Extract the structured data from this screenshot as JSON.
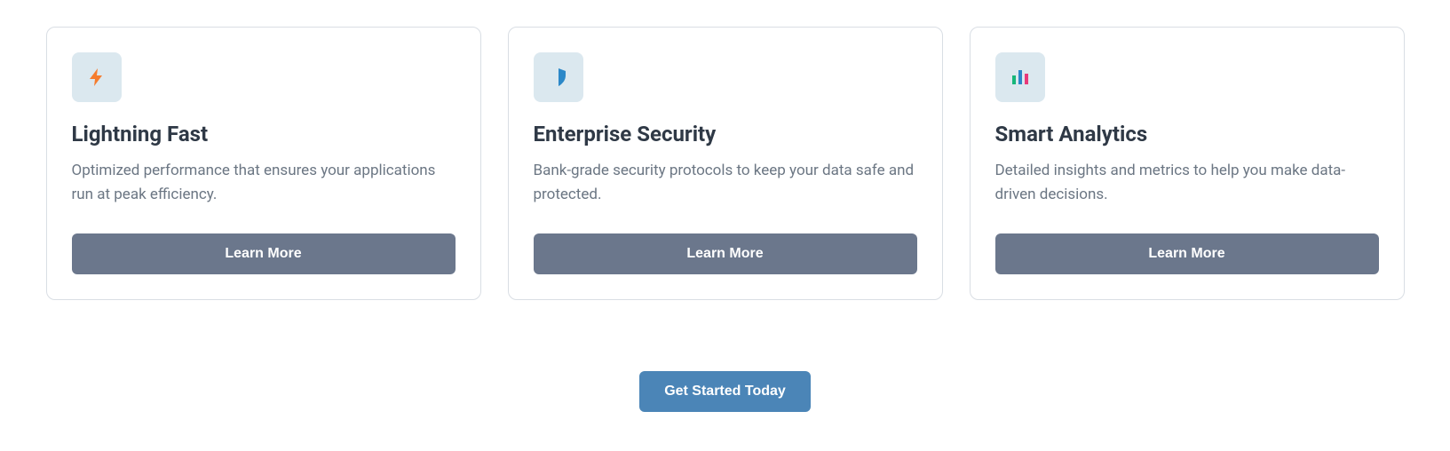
{
  "cards": [
    {
      "title": "Lightning Fast",
      "description": "Optimized performance that ensures your applications run at peak efficiency.",
      "button": "Learn More",
      "icon": "lightning"
    },
    {
      "title": "Enterprise Security",
      "description": "Bank-grade security protocols to keep your data safe and protected.",
      "button": "Learn More",
      "icon": "shield"
    },
    {
      "title": "Smart Analytics",
      "description": "Detailed insights and metrics to help you make data-driven decisions.",
      "button": "Learn More",
      "icon": "chart"
    }
  ],
  "cta": {
    "label": "Get Started Today"
  }
}
